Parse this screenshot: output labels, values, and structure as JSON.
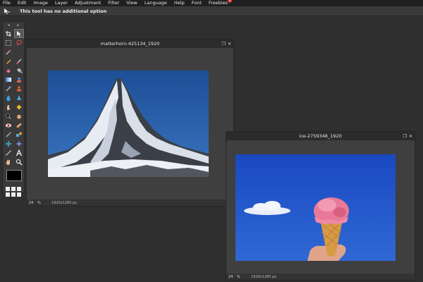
{
  "menubar": {
    "items": [
      "File",
      "Edit",
      "Image",
      "Layer",
      "Adjustment",
      "Filter",
      "View",
      "Language",
      "Help",
      "Font",
      "Freebies"
    ],
    "freebies_badge": "6"
  },
  "options_bar": {
    "message": "This tool has no additional option",
    "tool_icon": "move-cursor-icon"
  },
  "toolbox": {
    "collapse_left": "◂",
    "collapse_right": "▸",
    "foreground_color": "#000000"
  },
  "windows": [
    {
      "title": "matterhorn-425134_1920",
      "zoom": "24",
      "zoom_unit": "%",
      "size": "1920x1280 px"
    },
    {
      "title": "ice-2759348_1920",
      "zoom": "24",
      "zoom_unit": "%",
      "size": "1920x1280 px"
    }
  ]
}
